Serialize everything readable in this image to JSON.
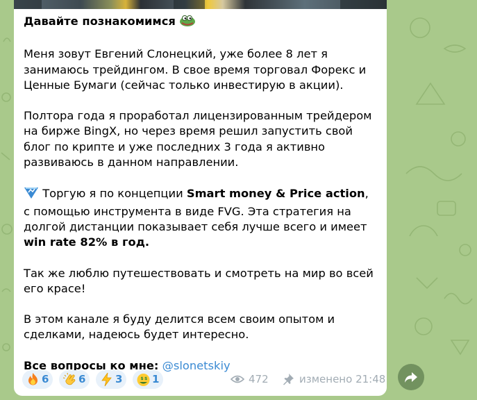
{
  "message": {
    "title": "Давайте познакомимся",
    "title_emoji": "pepe-frog-emoji",
    "paragraphs": {
      "p1": "Меня зовут Евгений Слонецкий, уже более 8 лет я занимаюсь трейдингом. В свое время торговал Форекс и Ценные Бумаги (сейчас только инвестирую в акции).",
      "p2": "Полтора года я проработал лицензированным трейдером на бирже BingX, но через время решил запустить свой блог по крипте и уже последних 3 года я активно развиваюсь в данном направлении."
    },
    "strategy": {
      "icon": "chart-emoji",
      "t1": "Торгую я по концепции ",
      "b1": "Smart money & Price action",
      "t2": ", с помощью инструмента в виде FVG. Эта стратегия на долгой дистанции показывает себя лучше всего и имеет ",
      "b2": "win rate 82% в год."
    },
    "p4": "Так же люблю путешествовать и смотреть на мир во всей его красе!",
    "p5": "В этом канале я буду делится всем своим опытом и сделками, надеюсь будет интересно.",
    "contact_label": "Все вопросы ко мне:",
    "contact_handle": "@slonetskiy"
  },
  "reactions": [
    {
      "icon": "fire-emoji",
      "count": "6"
    },
    {
      "icon": "clapping-hands-emoji",
      "count": "6"
    },
    {
      "icon": "lightning-emoji",
      "count": "3"
    },
    {
      "icon": "money-face-emoji",
      "count": "1"
    }
  ],
  "meta": {
    "views": "472",
    "edited_label": "изменено",
    "time": "21:48"
  },
  "colors": {
    "accent": "#3a8ad3",
    "meta": "#a2acb4",
    "wallpaper": "#a9c98b"
  }
}
